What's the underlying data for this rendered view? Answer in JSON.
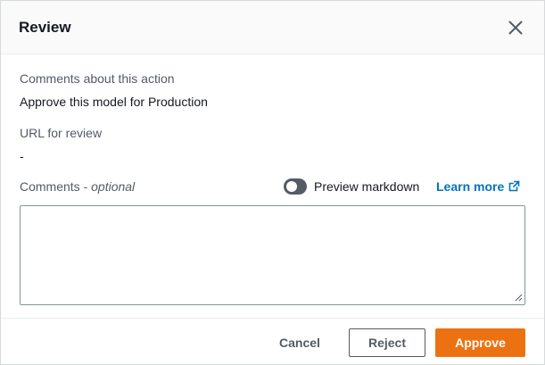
{
  "dialog": {
    "title": "Review",
    "close_icon": "close-icon"
  },
  "fields": {
    "comments_about_action": {
      "label": "Comments about this action",
      "value": "Approve this model for Production"
    },
    "url_for_review": {
      "label": "URL for review",
      "value": "-"
    },
    "comments": {
      "label": "Comments - ",
      "optional_label": "optional",
      "value": "",
      "placeholder": ""
    }
  },
  "preview_toggle": {
    "label": "Preview markdown",
    "checked": false
  },
  "learn_more": {
    "label": "Learn more",
    "icon": "external-link-icon",
    "color": "#0073bb"
  },
  "footer": {
    "cancel_label": "Cancel",
    "reject_label": "Reject",
    "approve_label": "Approve",
    "approve_color": "#ec7211"
  }
}
